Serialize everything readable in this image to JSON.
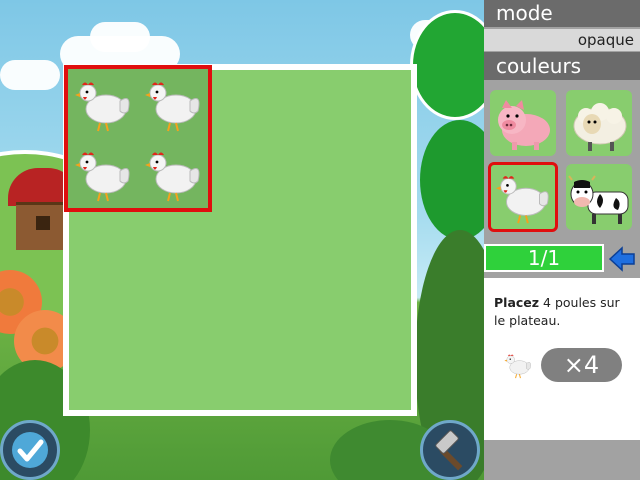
{
  "sidebar": {
    "mode_title": "mode",
    "mode_value": "opaque",
    "colors_title": "couleurs",
    "tiles": [
      {
        "animal": "pig-icon",
        "selected": false
      },
      {
        "animal": "sheep-icon",
        "selected": false
      },
      {
        "animal": "chicken-icon",
        "selected": true
      },
      {
        "animal": "cow-icon",
        "selected": false
      }
    ],
    "progress": "1/1",
    "progress_fraction": 1.0,
    "instruction_bold": "Placez",
    "instruction_rest": " 4 poules sur le plateau.",
    "count": "×4"
  },
  "board": {
    "group_rows": 2,
    "group_cols": 2
  },
  "buttons": {
    "validate": "check-icon",
    "hammer": "hammer-icon"
  },
  "colors": {
    "selection": "#e00e0e",
    "board_green": "#88cd6e",
    "progress_green": "#2fd13b",
    "arrow_blue": "#1f6fe0"
  }
}
